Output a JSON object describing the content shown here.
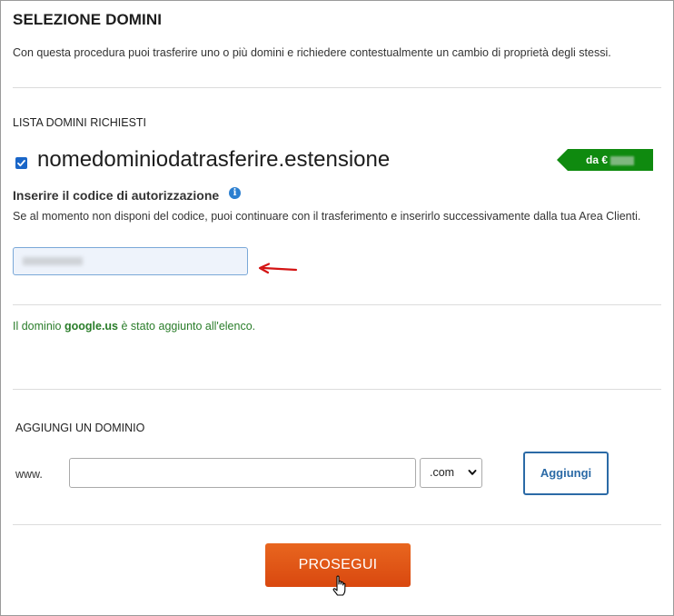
{
  "header": {
    "title": "SELEZIONE DOMINI",
    "intro": "Con questa procedura puoi trasferire uno o più domini e richiedere contestualmente un cambio di proprietà degli stessi."
  },
  "requested_list": {
    "label": "LISTA DOMINI RICHIESTI",
    "domain": {
      "checked": true,
      "name": "nomedominiodatrasferire.estensione",
      "price_prefix": "da €",
      "price_color": "#0f8a0f"
    },
    "auth_code": {
      "label": "Inserire il codice di autorizzazione",
      "info_icon": "info-icon",
      "help": "Se al momento non disponi del codice, puoi continuare con il trasferimento e inserirlo successivamente dalla tua Area Clienti."
    }
  },
  "notice": {
    "prefix": "Il dominio ",
    "domain": "google.us",
    "suffix": " è stato aggiunto all'elenco.",
    "color": "#2a7d2a"
  },
  "add_domain": {
    "label": "AGGIUNGI UN DOMINIO",
    "www_label": "www.",
    "input_value": "",
    "tld_selected": ".com",
    "add_button": "Aggiungi"
  },
  "footer": {
    "continue_button": "PROSEGUI",
    "accent_color": "#e0561a"
  }
}
